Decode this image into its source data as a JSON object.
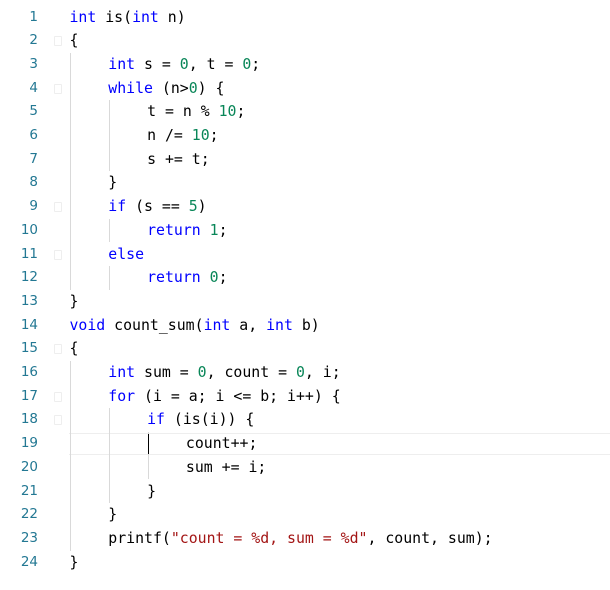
{
  "editor": {
    "lines": [
      {
        "n": "1",
        "indent": 0,
        "parts": [
          [
            "kw",
            "int"
          ],
          [
            "t",
            " is("
          ],
          [
            "kw",
            "int"
          ],
          [
            "t",
            " n)"
          ]
        ]
      },
      {
        "n": "2",
        "indent": 0,
        "parts": [
          [
            "t",
            "{"
          ]
        ]
      },
      {
        "n": "3",
        "indent": 1,
        "parts": [
          [
            "kw",
            "int"
          ],
          [
            "t",
            " s = "
          ],
          [
            "num",
            "0"
          ],
          [
            "t",
            ", t = "
          ],
          [
            "num",
            "0"
          ],
          [
            "t",
            ";"
          ]
        ]
      },
      {
        "n": "4",
        "indent": 1,
        "parts": [
          [
            "kw",
            "while"
          ],
          [
            "t",
            " (n>"
          ],
          [
            "num",
            "0"
          ],
          [
            "t",
            ") {"
          ]
        ]
      },
      {
        "n": "5",
        "indent": 2,
        "parts": [
          [
            "t",
            "t = n % "
          ],
          [
            "num",
            "10"
          ],
          [
            "t",
            ";"
          ]
        ]
      },
      {
        "n": "6",
        "indent": 2,
        "parts": [
          [
            "t",
            "n /= "
          ],
          [
            "num",
            "10"
          ],
          [
            "t",
            ";"
          ]
        ]
      },
      {
        "n": "7",
        "indent": 2,
        "parts": [
          [
            "t",
            "s += t;"
          ]
        ]
      },
      {
        "n": "8",
        "indent": 1,
        "parts": [
          [
            "t",
            "}"
          ]
        ]
      },
      {
        "n": "9",
        "indent": 1,
        "parts": [
          [
            "kw",
            "if"
          ],
          [
            "t",
            " (s == "
          ],
          [
            "num",
            "5"
          ],
          [
            "t",
            ")"
          ]
        ]
      },
      {
        "n": "10",
        "indent": 2,
        "parts": [
          [
            "kw",
            "return"
          ],
          [
            "t",
            " "
          ],
          [
            "num",
            "1"
          ],
          [
            "t",
            ";"
          ]
        ]
      },
      {
        "n": "11",
        "indent": 1,
        "parts": [
          [
            "kw",
            "else"
          ]
        ]
      },
      {
        "n": "12",
        "indent": 2,
        "parts": [
          [
            "kw",
            "return"
          ],
          [
            "t",
            " "
          ],
          [
            "num",
            "0"
          ],
          [
            "t",
            ";"
          ]
        ]
      },
      {
        "n": "13",
        "indent": 0,
        "parts": [
          [
            "t",
            "}"
          ]
        ]
      },
      {
        "n": "14",
        "indent": 0,
        "parts": [
          [
            "kw",
            "void"
          ],
          [
            "t",
            " count_sum("
          ],
          [
            "kw",
            "int"
          ],
          [
            "t",
            " a, "
          ],
          [
            "kw",
            "int"
          ],
          [
            "t",
            " b)"
          ]
        ]
      },
      {
        "n": "15",
        "indent": 0,
        "parts": [
          [
            "t",
            "{"
          ]
        ]
      },
      {
        "n": "16",
        "indent": 1,
        "parts": [
          [
            "kw",
            "int"
          ],
          [
            "t",
            " sum = "
          ],
          [
            "num",
            "0"
          ],
          [
            "t",
            ", count = "
          ],
          [
            "num",
            "0"
          ],
          [
            "t",
            ", i;"
          ]
        ]
      },
      {
        "n": "17",
        "indent": 1,
        "parts": [
          [
            "kw",
            "for"
          ],
          [
            "t",
            " (i = a; i <= b; i++) {"
          ]
        ]
      },
      {
        "n": "18",
        "indent": 2,
        "parts": [
          [
            "kw",
            "if"
          ],
          [
            "t",
            " (is(i)) {"
          ]
        ]
      },
      {
        "n": "19",
        "indent": 3,
        "parts": [
          [
            "t",
            "count++;"
          ]
        ]
      },
      {
        "n": "20",
        "indent": 3,
        "parts": [
          [
            "t",
            "sum += i;"
          ]
        ]
      },
      {
        "n": "21",
        "indent": 2,
        "parts": [
          [
            "t",
            "}"
          ]
        ]
      },
      {
        "n": "22",
        "indent": 1,
        "parts": [
          [
            "t",
            "}"
          ]
        ]
      },
      {
        "n": "23",
        "indent": 1,
        "parts": [
          [
            "t",
            "printf("
          ],
          [
            "str",
            "\"count = %d, sum = %d\""
          ],
          [
            "t",
            ", count, sum);"
          ]
        ]
      },
      {
        "n": "24",
        "indent": 0,
        "parts": [
          [
            "t",
            "}"
          ]
        ]
      }
    ],
    "current_line": 19,
    "colors": {
      "keyword": "#0000ff",
      "number": "#098658",
      "string": "#a31515",
      "line_number": "#237893",
      "text": "#000000"
    }
  }
}
